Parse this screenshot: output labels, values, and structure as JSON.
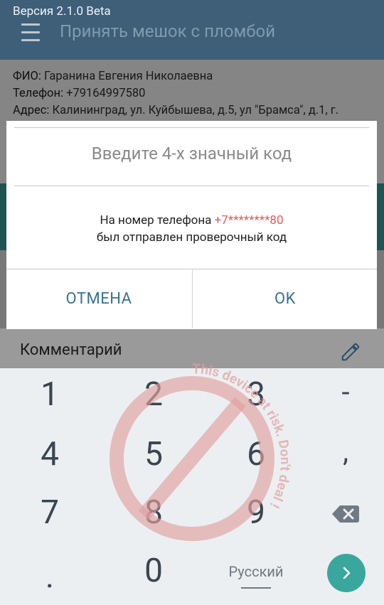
{
  "app": {
    "version": "Версия 2.1.0 Beta",
    "title": "Принять мешок с пломбой"
  },
  "customer": {
    "fio_label": "ФИО:",
    "fio_value": " Гаранина Евгения Николаевна",
    "phone_label": "Телефон:",
    "phone_value": " +79164997580",
    "address_label": "Адрес:",
    "address_value": " Калининград, ул. Куйбышева, д.5, ул \"Брамса\", д.1, г."
  },
  "comment": {
    "label": "Комментарий"
  },
  "dialog": {
    "title": "Введите 4-х значный код",
    "message_prefix": "На номер телефона ",
    "masked_phone": "+7********80",
    "message_line2": "был отправлен проверочный код",
    "cancel_label": "ОТМЕНА",
    "ok_label": "OK"
  },
  "keyboard": {
    "keys": [
      "1",
      "2",
      "3",
      "-",
      "4",
      "5",
      "6",
      ",",
      "7",
      "8",
      "9",
      ".",
      "0"
    ],
    "language": "Русский"
  },
  "watermark": {
    "text": "This device at risk. Don't deal !"
  },
  "colors": {
    "appbar": "#3f5f78",
    "accent_teal": "#3aa79e",
    "dialog_button": "#36728f",
    "masked_phone": "#e35a5a",
    "watermark": "#e2a0a0"
  },
  "icons": [
    "menu-icon",
    "pencil-icon",
    "backspace-icon",
    "arrow-right-icon",
    "prohibition-icon"
  ]
}
